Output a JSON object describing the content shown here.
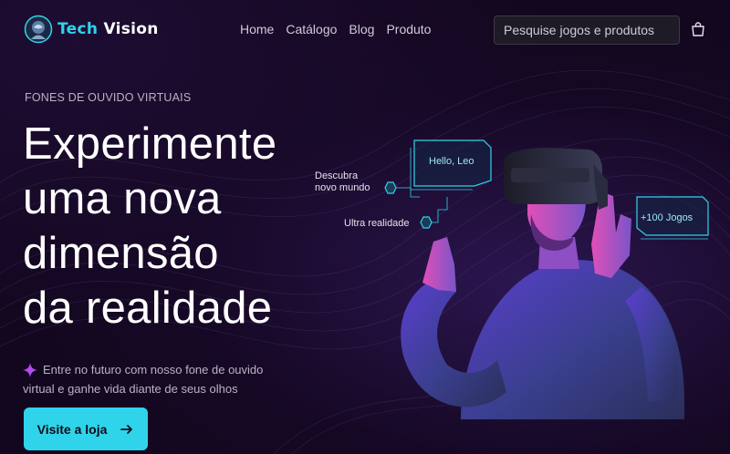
{
  "brand": {
    "name_part1": "Tech",
    "name_part2": "Vision"
  },
  "nav": {
    "items": [
      "Home",
      "Catálogo",
      "Blog",
      "Produto"
    ]
  },
  "search": {
    "placeholder": "Pesquise jogos e produtos"
  },
  "hero": {
    "eyebrow": "FONES DE OUVIDO VIRTUAIS",
    "headline_lines": [
      "Experimente",
      "uma nova",
      "dimensão",
      "da realidade"
    ],
    "subtitle_line1": "Entre no futuro com nosso fone de ouvido",
    "subtitle_line2": "virtual e ganhe vida diante de seus olhos",
    "cta_label": "Visite a loja"
  },
  "hud": {
    "greeting": "Hello, Leo",
    "label_discover_line1": "Descubra",
    "label_discover_line2": "novo mundo",
    "label_ultra": "Ultra realidade",
    "games_badge": "+100 Jogos"
  },
  "icons": {
    "logo": "astronaut-logo-icon",
    "cart": "shopping-bag-icon",
    "spark": "sparkle-icon",
    "arrow": "arrow-right-icon"
  },
  "colors": {
    "accent": "#2fd4ea",
    "spark": "#b44cf0",
    "background": "#13071f"
  }
}
